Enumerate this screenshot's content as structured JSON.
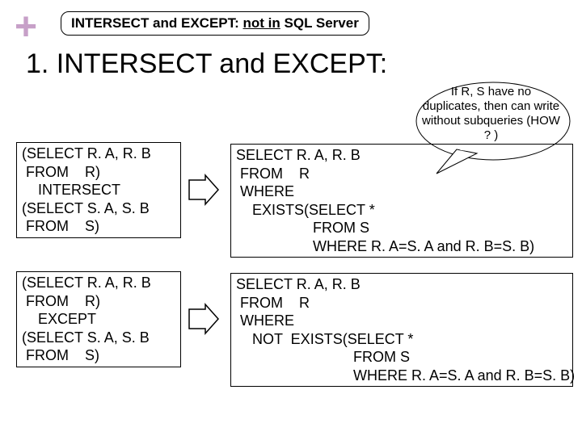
{
  "plus": "+",
  "topbox": {
    "prefix": "INTERSECT and EXCEPT: ",
    "under": "not in",
    "suffix": " SQL Server"
  },
  "title": "1. INTERSECT and EXCEPT:",
  "callout": "If R, S have no duplicates, then can write without subqueries (HOW ? )",
  "box1": "(SELECT R. A, R. B\n FROM    R)\n    INTERSECT\n(SELECT S. A, S. B\n FROM    S)",
  "box2": "SELECT R. A, R. B\n FROM    R\n WHERE\n    EXISTS(SELECT *\n                   FROM S\n                   WHERE R. A=S. A and R. B=S. B)",
  "box3": "(SELECT R. A, R. B\n FROM    R)\n    EXCEPT\n(SELECT S. A, S. B\n FROM    S)",
  "box4": "SELECT R. A, R. B\n FROM    R\n WHERE\n    NOT  EXISTS(SELECT *\n                             FROM S\n                             WHERE R. A=S. A and R. B=S. B)"
}
